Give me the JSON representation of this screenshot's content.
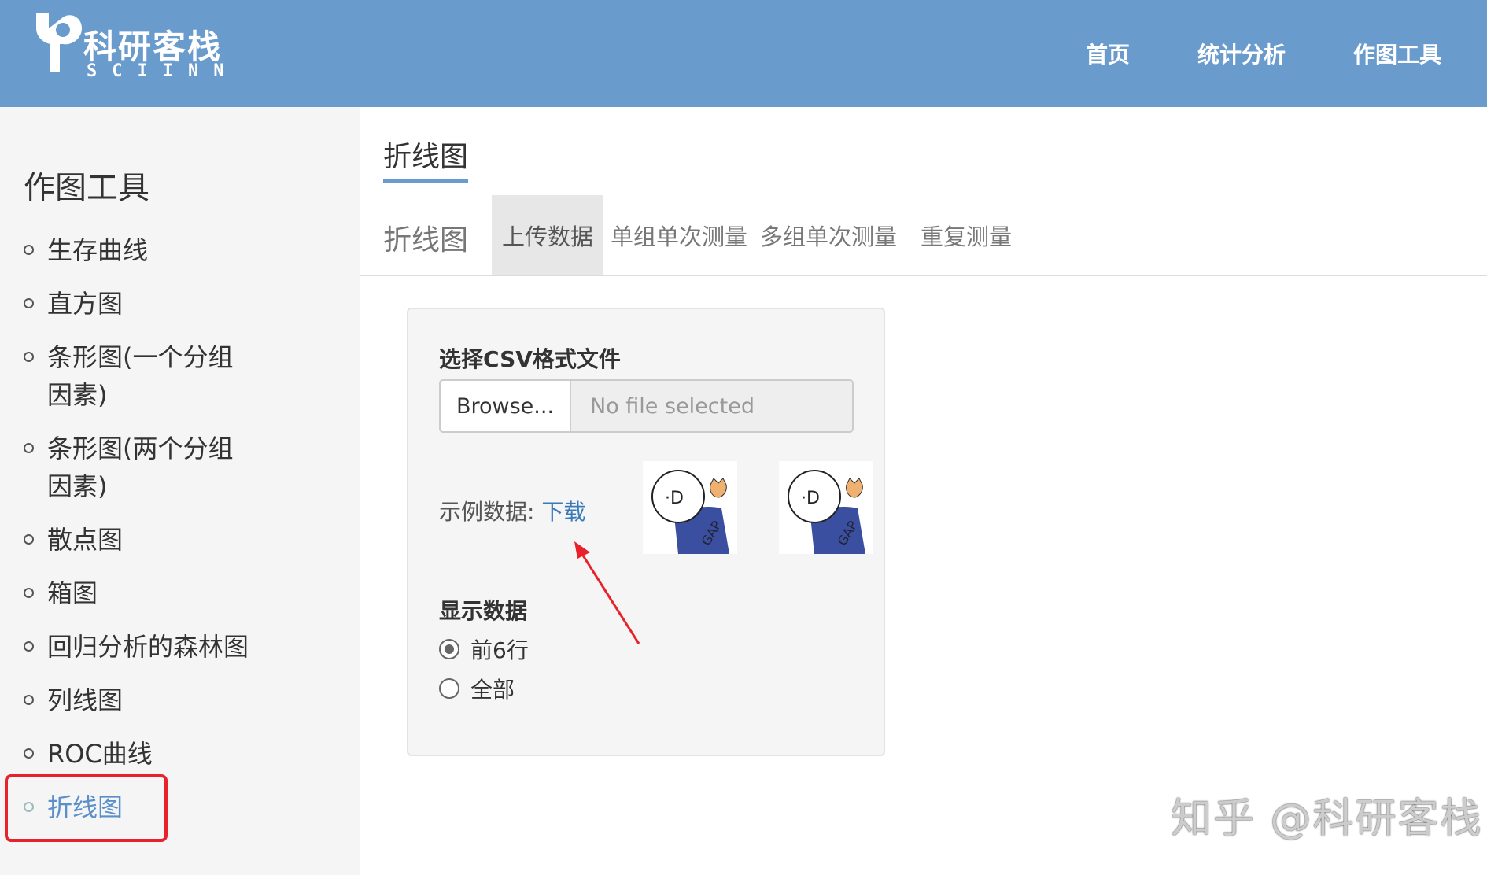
{
  "header": {
    "logo_cn": "科研客栈",
    "logo_en": "SCIINN",
    "nav": [
      "首页",
      "统计分析",
      "作图工具"
    ]
  },
  "sidebar": {
    "title": "作图工具",
    "items": [
      {
        "label": "生存曲线"
      },
      {
        "label": "直方图"
      },
      {
        "label": "条形图(一个分组因素)"
      },
      {
        "label": "条形图(两个分组因素)"
      },
      {
        "label": "散点图"
      },
      {
        "label": "箱图"
      },
      {
        "label": "回归分析的森林图"
      },
      {
        "label": "列线图"
      },
      {
        "label": "ROC曲线"
      },
      {
        "label": "折线图"
      }
    ],
    "active_index": 9
  },
  "main": {
    "page_title": "折线图",
    "tab_brand": "折线图",
    "tabs": [
      "上传数据",
      "单组单次测量",
      "多组单次测量",
      "重复测量"
    ],
    "active_tab": 0
  },
  "panel": {
    "csv_label": "选择CSV格式文件",
    "browse_label": "Browse...",
    "file_placeholder": "No file selected",
    "sample_label": "示例数据: ",
    "sample_link": "下载",
    "show_label": "显示数据",
    "radio_options": [
      "前6行",
      "全部"
    ],
    "radio_selected": 0
  },
  "watermark": "知乎 @科研客栈",
  "colors": {
    "header_bg": "#6a9bcd",
    "link": "#3a7ab8",
    "highlight_box": "#e8222a",
    "arrow": "#e8222a"
  }
}
